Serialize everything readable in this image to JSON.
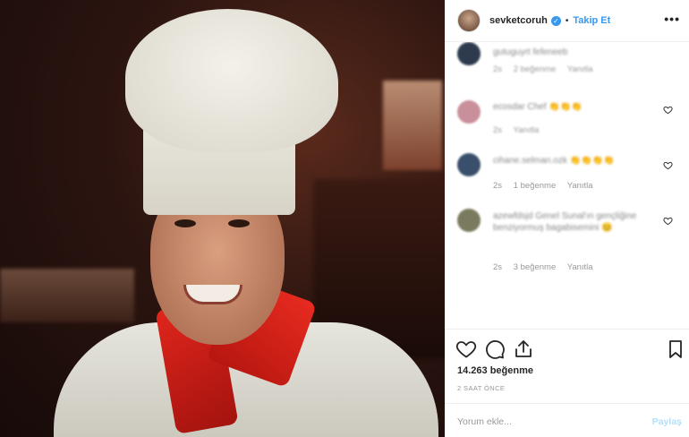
{
  "photo": {
    "alt_icon": "chef-portrait-photo"
  },
  "header": {
    "username": "sevketcoruh",
    "verified_icon": "verified-badge-icon",
    "separator": "•",
    "follow_label": "Takip Et",
    "more_label": "•••"
  },
  "comments": [
    {
      "text": "gutuguyrt fefeneeb",
      "meta": [
        "2s",
        "2 beğenme",
        "Yanıtla"
      ],
      "avatar_color": "#2e3b4e",
      "blurred_meta": true
    },
    {
      "text": "ecosdar Chef 👏👏👏",
      "meta": [
        "2s",
        "Yanıtla"
      ],
      "avatar_color": "#c98f9a",
      "blurred_meta": true
    },
    {
      "text": "cihane.selman.ozk 👏👏👏👏",
      "meta": [
        "2s",
        "1 beğenme",
        "Yanıtla"
      ],
      "avatar_color": "#3a4f6b",
      "blurred_meta": false
    },
    {
      "text": "azewfdsjd Genel Sunal'ın gençliğine benziyormuş bagabisemini 😊",
      "meta": [
        "2s",
        "3 beğenme",
        "Yanıtla"
      ],
      "avatar_color": "#7a7a5e",
      "blurred_meta": false
    }
  ],
  "load_more_icon": "plus-circle-icon",
  "actions": {
    "like_icon": "heart-icon",
    "comment_icon": "comment-icon",
    "share_icon": "share-icon",
    "save_icon": "bookmark-icon",
    "likes_text": "14.263 beğenme",
    "time_text": "2 SAAT ÖNCE"
  },
  "add_comment": {
    "placeholder": "Yorum ekle...",
    "post_label": "Paylaş"
  },
  "colors": {
    "accent": "#3897f0",
    "post_disabled": "#b2dffc",
    "border": "#efefef"
  }
}
